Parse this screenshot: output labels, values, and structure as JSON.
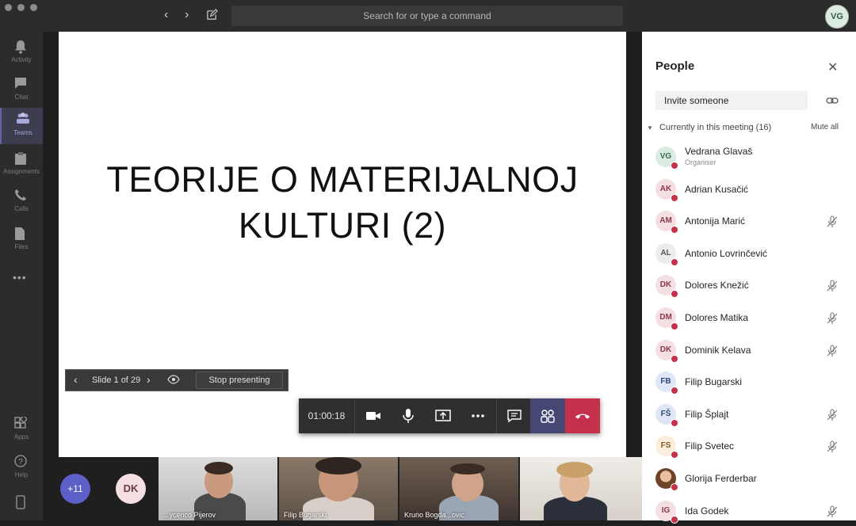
{
  "header": {
    "search_placeholder": "Search for or type a command",
    "user_initials": "VG"
  },
  "rail": {
    "items": [
      {
        "label": "Activity",
        "icon": "bell-icon"
      },
      {
        "label": "Chat",
        "icon": "chat-icon"
      },
      {
        "label": "Teams",
        "icon": "teams-icon"
      },
      {
        "label": "Assignments",
        "icon": "assignments-icon"
      },
      {
        "label": "Calls",
        "icon": "phone-icon"
      },
      {
        "label": "Files",
        "icon": "file-icon"
      }
    ],
    "more": "•••",
    "bottom": [
      {
        "label": "Apps",
        "icon": "apps-icon"
      },
      {
        "label": "Help",
        "icon": "help-icon"
      }
    ]
  },
  "slide": {
    "title_line1": "TEORIJE O MATERIJALNOJ",
    "title_line2": "KULTURI (2)"
  },
  "slide_controls": {
    "counter": "Slide 1 of 29",
    "stop_label": "Stop presenting"
  },
  "call": {
    "timer": "01:00:18"
  },
  "strip": {
    "overflow_count": "+11",
    "avatar_initials": "DK",
    "tiles": [
      {
        "name": "...ycenco Pijerov"
      },
      {
        "name": "Filip Bugarski"
      },
      {
        "name": "Kruṅo Bogda...ovic"
      },
      {
        "name": ""
      }
    ]
  },
  "people": {
    "title": "People",
    "invite_placeholder": "Invite someone",
    "section_label": "Currently in this meeting",
    "section_count": "(16)",
    "mute_all": "Mute all",
    "participants": [
      {
        "initials": "VG",
        "name": "Vedrana Glavaš",
        "role": "Organiser",
        "bg": "#d9ecdf",
        "fg": "#3a6b4b",
        "muted": false
      },
      {
        "initials": "AK",
        "name": "Adrian Kusačić",
        "role": "",
        "bg": "#f6dfe2",
        "fg": "#8a3a48",
        "muted": false
      },
      {
        "initials": "AM",
        "name": "Antonija Marić",
        "role": "",
        "bg": "#f6dfe2",
        "fg": "#8a3a48",
        "muted": true
      },
      {
        "initials": "AL",
        "name": "Antonio Lovrinčević",
        "role": "",
        "bg": "#ececec",
        "fg": "#555",
        "muted": false
      },
      {
        "initials": "DK",
        "name": "Dolores Knežić",
        "role": "",
        "bg": "#f6dfe2",
        "fg": "#8a3a48",
        "muted": true
      },
      {
        "initials": "DM",
        "name": "Dolores Matika",
        "role": "",
        "bg": "#f6dfe2",
        "fg": "#8a3a48",
        "muted": true
      },
      {
        "initials": "DK",
        "name": "Dominik Kelava",
        "role": "",
        "bg": "#f6dfe2",
        "fg": "#8a3a48",
        "muted": true
      },
      {
        "initials": "FB",
        "name": "Filip Bugarski",
        "role": "",
        "bg": "#dfe6f5",
        "fg": "#2f4a80",
        "muted": false
      },
      {
        "initials": "FŠ",
        "name": "Filip Šplajt",
        "role": "",
        "bg": "#dfe6f5",
        "fg": "#2f4a80",
        "muted": true
      },
      {
        "initials": "FS",
        "name": "Filip Svetec",
        "role": "",
        "bg": "#fbeedc",
        "fg": "#8a5a20",
        "muted": true
      },
      {
        "initials": "",
        "name": "Glorija Ferderbar",
        "role": "",
        "bg": "#c98a55",
        "fg": "#fff",
        "muted": false,
        "photo": true
      },
      {
        "initials": "IG",
        "name": "Ida Godek",
        "role": "",
        "bg": "#f6dfe2",
        "fg": "#8a3a48",
        "muted": true
      }
    ]
  }
}
